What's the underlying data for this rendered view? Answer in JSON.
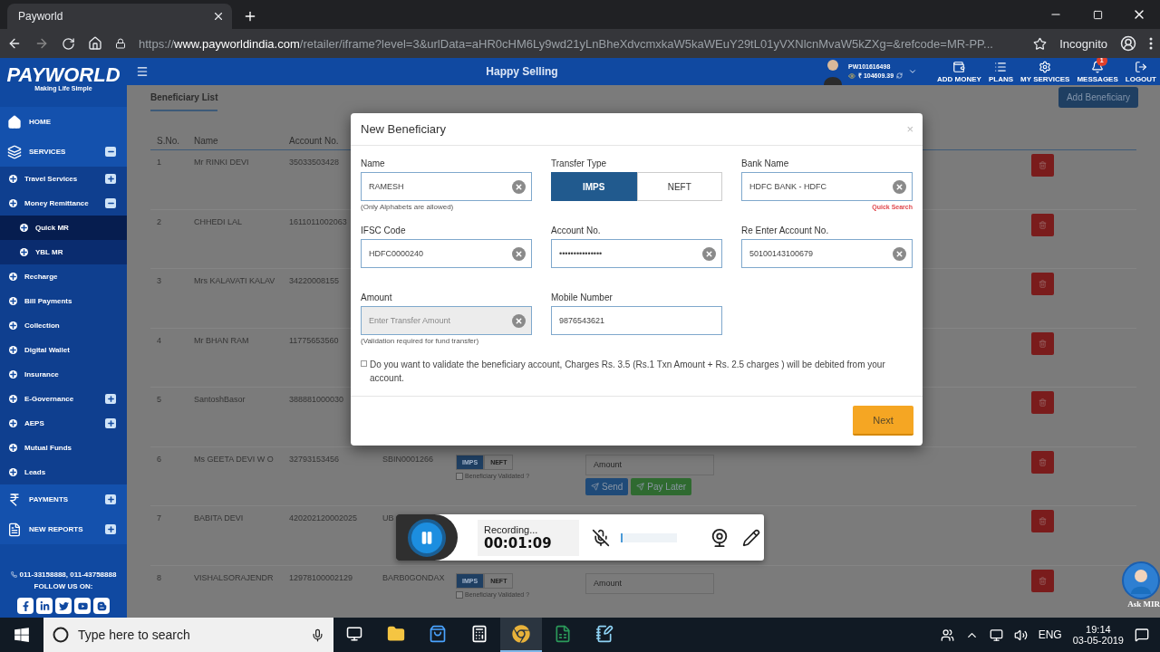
{
  "browser": {
    "tab": {
      "title": "Payworld"
    },
    "url": "https://**www.payworldindia.com**/retailer/iframe?level=3&urlData=aHR0cHM6Ly9wd21yLnBheXdvcmxkaW5kaWEuY29tL01yVXNlcnMvaW5kZXg=&refcode=MR-PP...",
    "profile": "Incognito"
  },
  "header": {
    "tagline": "Happy Selling",
    "user_id": "PW101616498",
    "balance": "₹ 104609.39",
    "nav": [
      {
        "kind": "wallet",
        "label": "ADD MONEY"
      },
      {
        "kind": "list",
        "label": "PLANS"
      },
      {
        "kind": "gear",
        "label": "MY SERVICES"
      },
      {
        "kind": "bell",
        "label": "MESSAGES",
        "badge": "1"
      },
      {
        "kind": "logout",
        "label": "LOGOUT"
      }
    ]
  },
  "sidebar": {
    "logo": "PAYWORLD",
    "logo_tagline": "Making Life Simple",
    "items": [
      {
        "kind": "home",
        "label": "HOME",
        "selected": false
      },
      {
        "kind": "services",
        "label": "SERVICES",
        "selected": false,
        "expanded": true,
        "children": [
          {
            "label": "Travel Services",
            "selected": false,
            "expanded": false
          },
          {
            "label": "Money Remittance",
            "selected": false,
            "expanded": true,
            "children": [
              {
                "label": "Quick MR",
                "selected": true
              },
              {
                "label": "YBL MR",
                "selected": false
              }
            ]
          },
          {
            "label": "Recharge",
            "selected": false
          },
          {
            "label": "Bill Payments",
            "selected": false
          },
          {
            "label": "Collection",
            "selected": false
          },
          {
            "label": "Digital Wallet",
            "selected": false
          },
          {
            "label": "Insurance",
            "selected": false
          },
          {
            "label": "E-Governance",
            "selected": false,
            "expanded": false
          },
          {
            "label": "AEPS",
            "selected": false,
            "expanded": false
          },
          {
            "label": "Mutual Funds",
            "selected": false
          },
          {
            "label": "Leads",
            "selected": false
          }
        ]
      },
      {
        "kind": "rupee",
        "label": "PAYMENTS",
        "selected": false,
        "expanded": false
      },
      {
        "kind": "report",
        "label": "NEW REPORTS",
        "selected": false,
        "expanded": false
      }
    ],
    "phone": "011-33158888, 011-43758888",
    "follow": "FOLLOW US ON:"
  },
  "content": {
    "tab": "Beneficiary List",
    "add_button": "Add Beneficiary",
    "columns": [
      "S.No.",
      "Name",
      "Account No."
    ],
    "rows": [
      {
        "sno": "1",
        "name": "Mr RINKI DEVI",
        "account": "35033503428"
      },
      {
        "sno": "2",
        "name": "CHHEDI LAL",
        "account": "1611011002063"
      },
      {
        "sno": "3",
        "name": "Mrs KALAVATI KALAV",
        "account": "34220008155"
      },
      {
        "sno": "4",
        "name": "Mr BHAN RAM",
        "account": "11775653560"
      },
      {
        "sno": "5",
        "name": "SantoshBasor",
        "account": "388881000030"
      },
      {
        "sno": "6",
        "name": "Ms GEETA DEVI W O",
        "account": "32793153456",
        "ifsc": "SBIN0001266",
        "modes": [
          {
            "label": "IMPS",
            "selected": true
          },
          {
            "label": "NEFT",
            "selected": false
          }
        ],
        "validated": {
          "label": "Beneficiary Validated ?",
          "checked": false
        },
        "amount_placeholder": "Amount",
        "send": "Send",
        "pay_later": "Pay Later"
      },
      {
        "sno": "7",
        "name": "BABITA DEVI",
        "account": "420202120002025",
        "ifsc": "UB"
      },
      {
        "sno": "8",
        "name": "VISHALSORAJENDR",
        "account": "12978100002129",
        "ifsc": "BARB0GONDAX",
        "modes": [
          {
            "label": "IMPS",
            "selected": true
          },
          {
            "label": "NEFT",
            "selected": false
          }
        ],
        "validated": {
          "label": "Beneficiary Validated ?",
          "checked": false
        },
        "amount_placeholder": "Amount"
      }
    ]
  },
  "modal": {
    "title": "New Beneficiary",
    "close": "×",
    "fields": [
      {
        "kind": "input",
        "label": "Name",
        "value": "RAMESH",
        "clearable": true,
        "hint": "(Only Alphabets are allowed)"
      },
      {
        "kind": "segmented",
        "label": "Transfer Type",
        "options": [
          {
            "label": "IMPS",
            "selected": true
          },
          {
            "label": "NEFT",
            "selected": false
          }
        ]
      },
      {
        "kind": "input",
        "label": "Bank Name",
        "value": "HDFC BANK - HDFC",
        "clearable": true,
        "link": "Quick Search"
      },
      {
        "kind": "input",
        "label": "IFSC Code",
        "value": "HDFC0000240",
        "clearable": true
      },
      {
        "kind": "input",
        "label": "Account No.",
        "value": "•••••••••••••••",
        "clearable": true
      },
      {
        "kind": "input",
        "label": "Re Enter Account No.",
        "value": "50100143100679",
        "clearable": true
      },
      {
        "kind": "input",
        "label": "Amount",
        "placeholder": "Enter Transfer Amount",
        "disabled": true,
        "clearable": true,
        "hint": "(Validation required for fund transfer)"
      },
      {
        "kind": "input",
        "label": "Mobile Number",
        "value": "9876543621"
      }
    ],
    "consent": {
      "checked": false,
      "text": "Do you want to validate the beneficiary account, Charges Rs. 3.5 (Rs.1 Txn Amount + Rs. 2.5 charges ) will be debited from your account."
    },
    "next": "Next"
  },
  "recorder": {
    "status": "Recording...",
    "time": "00:01:09",
    "level": 0.03
  },
  "assistant": {
    "label": "Ask MIR"
  },
  "taskbar": {
    "search_placeholder": "Type here to search",
    "apps": [
      {
        "kind": "folder",
        "selected": false
      },
      {
        "kind": "store",
        "selected": false
      },
      {
        "kind": "calculator",
        "selected": false
      },
      {
        "kind": "chrome",
        "selected": true
      },
      {
        "kind": "excel",
        "selected": false
      },
      {
        "kind": "notepad",
        "selected": false
      }
    ],
    "language": "ENG",
    "time": "19:14",
    "date": "03-05-2019"
  }
}
